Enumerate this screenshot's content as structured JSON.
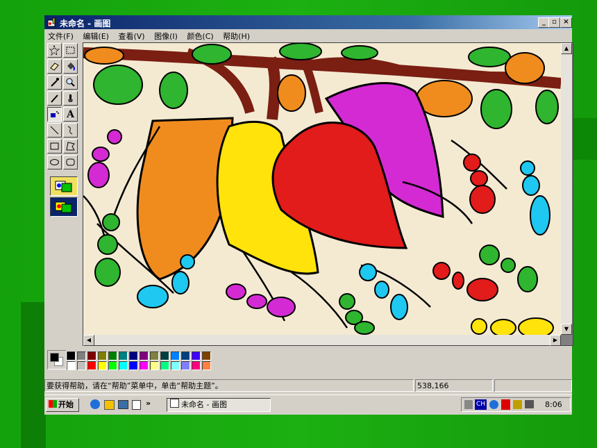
{
  "window": {
    "title": "未命名 - 画图",
    "buttons": {
      "minimize": "_",
      "maximize": "▫",
      "close": "×"
    }
  },
  "menu": [
    "文件(F)",
    "编辑(E)",
    "查看(V)",
    "图像(I)",
    "颜色(C)",
    "帮助(H)"
  ],
  "tools": [
    {
      "name": "free-select-tool",
      "icon": "star-select"
    },
    {
      "name": "rect-select-tool",
      "icon": "dashed-rect"
    },
    {
      "name": "eraser-tool",
      "icon": "eraser"
    },
    {
      "name": "fill-tool",
      "icon": "bucket"
    },
    {
      "name": "pick-color-tool",
      "icon": "dropper"
    },
    {
      "name": "magnifier-tool",
      "icon": "magnifier"
    },
    {
      "name": "pencil-tool",
      "icon": "pencil"
    },
    {
      "name": "brush-tool",
      "icon": "brush"
    },
    {
      "name": "airbrush-tool",
      "icon": "airbrush"
    },
    {
      "name": "text-tool",
      "icon": "text-A"
    },
    {
      "name": "line-tool",
      "icon": "line"
    },
    {
      "name": "curve-tool",
      "icon": "curve"
    },
    {
      "name": "rectangle-tool",
      "icon": "rectangle"
    },
    {
      "name": "polygon-tool",
      "icon": "polygon"
    },
    {
      "name": "ellipse-tool",
      "icon": "ellipse"
    },
    {
      "name": "rounded-rect-tool",
      "icon": "rounded-rect"
    }
  ],
  "text_tool_label": "A",
  "palette": {
    "foreground": "#000000",
    "background": "#ffffff",
    "row1": [
      "#000000",
      "#808080",
      "#800000",
      "#808000",
      "#008000",
      "#008080",
      "#000080",
      "#800080",
      "#808040",
      "#004040",
      "#0080ff",
      "#004080",
      "#4000ff",
      "#804000"
    ],
    "row2": [
      "#ffffff",
      "#c0c0c0",
      "#ff0000",
      "#ffff00",
      "#00ff00",
      "#00ffff",
      "#0000ff",
      "#ff00ff",
      "#ffff80",
      "#00ff80",
      "#80ffff",
      "#8080ff",
      "#ff0080",
      "#ff8040"
    ]
  },
  "status": {
    "help": "要获得帮助，请在“帮助”菜单中，单击“帮助主题”。",
    "coords": "538,166"
  },
  "taskbar": {
    "start": "开始",
    "more": "»",
    "task": "未命名 - 画图",
    "clock": "8:06",
    "ime": "CH"
  }
}
